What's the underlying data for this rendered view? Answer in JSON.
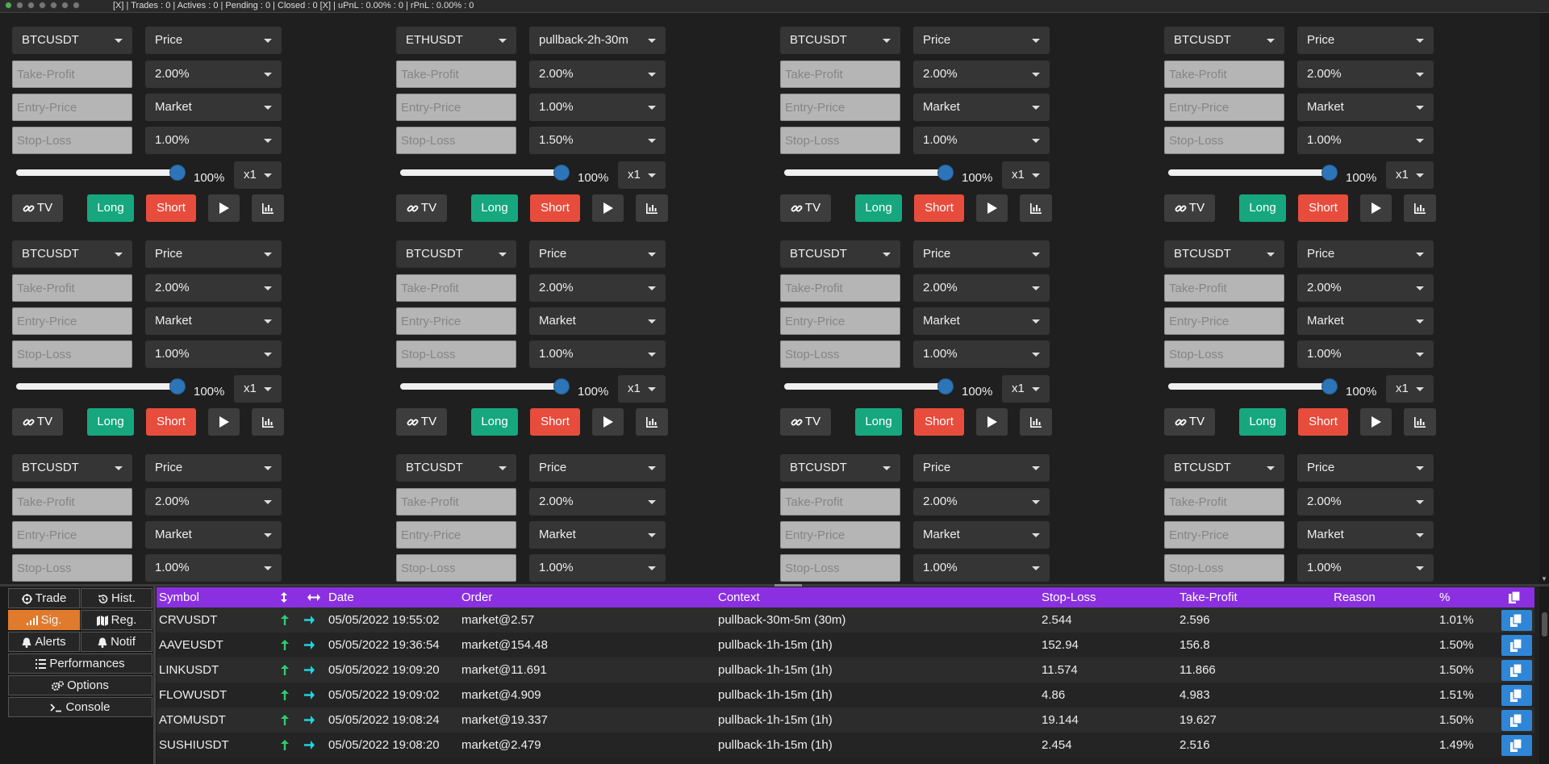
{
  "status_bar": {
    "text": "[X] | Trades : 0 | Actives : 0 | Pending : 0 | Closed : 0 [X] | uPnL : 0.00% : 0 | rPnL : 0.00% : 0"
  },
  "panel_labels": {
    "tp_placeholder": "Take-Profit",
    "ep_placeholder": "Entry-Price",
    "sl_placeholder": "Stop-Loss",
    "tv": "TV",
    "long": "Long",
    "short": "Short"
  },
  "panels": [
    {
      "symbol": "BTCUSDT",
      "context": "Price",
      "tp": "2.00%",
      "entry": "Market",
      "sl": "1.00%",
      "percent": "100%",
      "leverage": "x1"
    },
    {
      "symbol": "ETHUSDT",
      "context": "pullback-2h-30m",
      "tp": "2.00%",
      "entry": "1.00%",
      "sl": "1.50%",
      "percent": "100%",
      "leverage": "x1"
    },
    {
      "symbol": "BTCUSDT",
      "context": "Price",
      "tp": "2.00%",
      "entry": "Market",
      "sl": "1.00%",
      "percent": "100%",
      "leverage": "x1"
    },
    {
      "symbol": "BTCUSDT",
      "context": "Price",
      "tp": "2.00%",
      "entry": "Market",
      "sl": "1.00%",
      "percent": "100%",
      "leverage": "x1"
    },
    {
      "symbol": "BTCUSDT",
      "context": "Price",
      "tp": "2.00%",
      "entry": "Market",
      "sl": "1.00%",
      "percent": "100%",
      "leverage": "x1"
    },
    {
      "symbol": "BTCUSDT",
      "context": "Price",
      "tp": "2.00%",
      "entry": "Market",
      "sl": "1.00%",
      "percent": "100%",
      "leverage": "x1"
    },
    {
      "symbol": "BTCUSDT",
      "context": "Price",
      "tp": "2.00%",
      "entry": "Market",
      "sl": "1.00%",
      "percent": "100%",
      "leverage": "x1"
    },
    {
      "symbol": "BTCUSDT",
      "context": "Price",
      "tp": "2.00%",
      "entry": "Market",
      "sl": "1.00%",
      "percent": "100%",
      "leverage": "x1"
    },
    {
      "symbol": "BTCUSDT",
      "context": "Price",
      "tp": "2.00%",
      "entry": "Market",
      "sl": "1.00%"
    },
    {
      "symbol": "BTCUSDT",
      "context": "Price",
      "tp": "2.00%",
      "entry": "Market",
      "sl": "1.00%"
    },
    {
      "symbol": "BTCUSDT",
      "context": "Price",
      "tp": "2.00%",
      "entry": "Market",
      "sl": "1.00%"
    },
    {
      "symbol": "BTCUSDT",
      "context": "Price",
      "tp": "2.00%",
      "entry": "Market",
      "sl": "1.00%"
    }
  ],
  "tabs": {
    "trade": "Trade",
    "hist": "Hist.",
    "sig": "Sig.",
    "reg": "Reg.",
    "alerts": "Alerts",
    "notif": "Notif",
    "performances": "Performances",
    "options": "Options",
    "console": "Console"
  },
  "signals_table": {
    "headers": {
      "symbol": "Symbol",
      "date": "Date",
      "order": "Order",
      "context": "Context",
      "stop_loss": "Stop-Loss",
      "take_profit": "Take-Profit",
      "reason": "Reason",
      "percent": "%"
    },
    "rows": [
      {
        "symbol": "CRVUSDT",
        "date": "05/05/2022 19:55:02",
        "order": "market@2.57",
        "context": "pullback-30m-5m (30m)",
        "sl": "2.544",
        "tp": "2.596",
        "reason": "",
        "pct": "1.01%"
      },
      {
        "symbol": "AAVEUSDT",
        "date": "05/05/2022 19:36:54",
        "order": "market@154.48",
        "context": "pullback-1h-15m (1h)",
        "sl": "152.94",
        "tp": "156.8",
        "reason": "",
        "pct": "1.50%"
      },
      {
        "symbol": "LINKUSDT",
        "date": "05/05/2022 19:09:20",
        "order": "market@11.691",
        "context": "pullback-1h-15m (1h)",
        "sl": "11.574",
        "tp": "11.866",
        "reason": "",
        "pct": "1.50%"
      },
      {
        "symbol": "FLOWUSDT",
        "date": "05/05/2022 19:09:02",
        "order": "market@4.909",
        "context": "pullback-1h-15m (1h)",
        "sl": "4.86",
        "tp": "4.983",
        "reason": "",
        "pct": "1.51%"
      },
      {
        "symbol": "ATOMUSDT",
        "date": "05/05/2022 19:08:24",
        "order": "market@19.337",
        "context": "pullback-1h-15m (1h)",
        "sl": "19.144",
        "tp": "19.627",
        "reason": "",
        "pct": "1.50%"
      },
      {
        "symbol": "SUSHIUSDT",
        "date": "05/05/2022 19:08:20",
        "order": "market@2.479",
        "context": "pullback-1h-15m (1h)",
        "sl": "2.454",
        "tp": "2.516",
        "reason": "",
        "pct": "1.49%"
      }
    ]
  },
  "colors": {
    "long": "#16a77e",
    "short": "#e74c3c",
    "header": "#8a30e0",
    "active_tab": "#e07a2c",
    "copy": "#2f86d6",
    "arrow_up": "#2ecc71",
    "arrow_right": "#1fd5e0"
  }
}
